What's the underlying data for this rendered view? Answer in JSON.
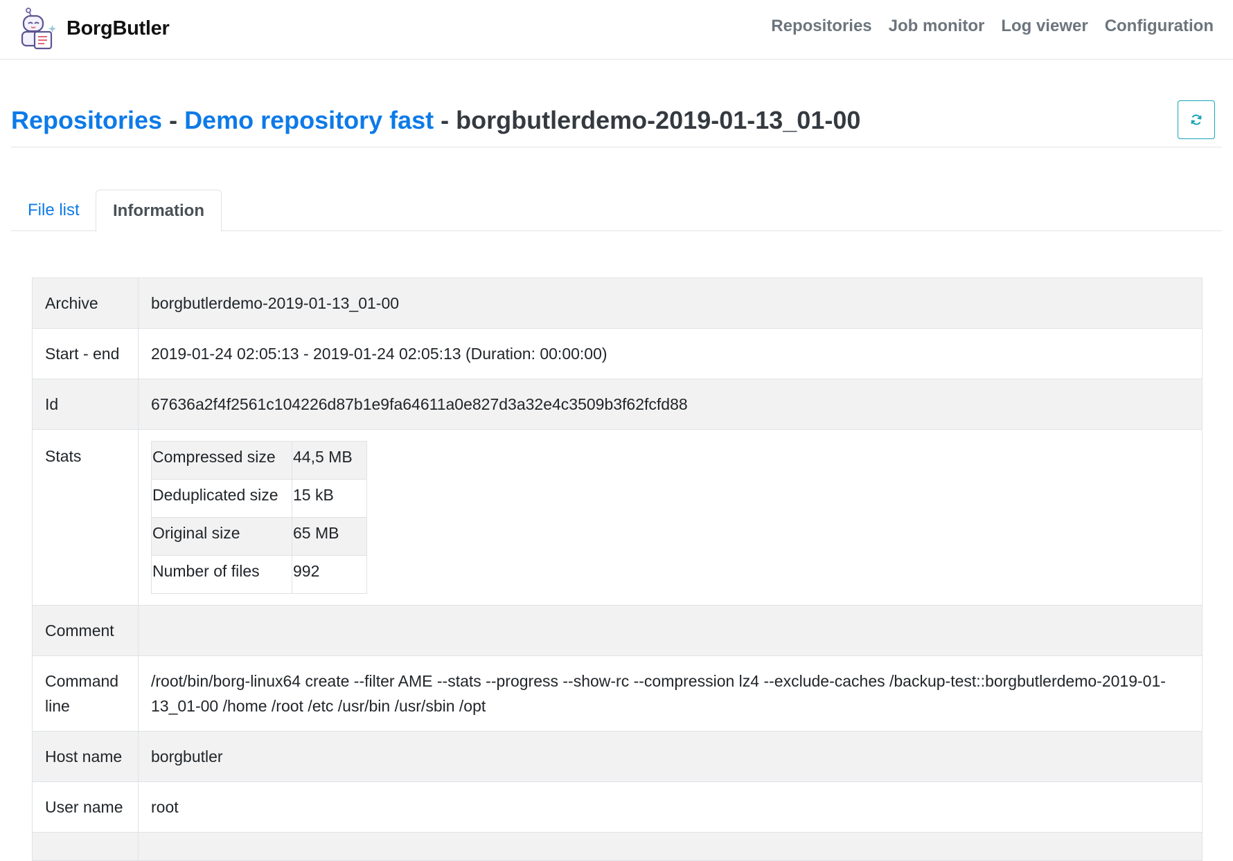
{
  "app": {
    "name": "BorgButler",
    "logo_icon": "borgbutler-logo-icon"
  },
  "nav": {
    "items": [
      {
        "label": "Repositories"
      },
      {
        "label": "Job monitor"
      },
      {
        "label": "Log viewer"
      },
      {
        "label": "Configuration"
      }
    ]
  },
  "header": {
    "crumb_repositories": "Repositories",
    "separator": " - ",
    "crumb_repository": "Demo repository fast",
    "archive_title": "borgbutlerdemo-2019-01-13_01-00",
    "refresh_icon": "refresh-icon"
  },
  "tabs": [
    {
      "label": "File list",
      "active": false
    },
    {
      "label": "Information",
      "active": true
    }
  ],
  "info": {
    "rows": [
      {
        "key": "Archive",
        "value": "borgbutlerdemo-2019-01-13_01-00"
      },
      {
        "key": "Start - end",
        "value": "2019-01-24 02:05:13 - 2019-01-24 02:05:13 (Duration: 00:00:00)"
      },
      {
        "key": "Id",
        "value": "67636a2f4f2561c104226d87b1e9fa64611a0e827d3a32e4c3509b3f62fcfd88"
      },
      {
        "key": "Stats",
        "value": ""
      },
      {
        "key": "Comment",
        "value": ""
      },
      {
        "key": "Command line",
        "value": "/root/bin/borg-linux64 create --filter AME --stats --progress --show-rc --compression lz4 --exclude-caches /backup-test::borgbutlerdemo-2019-01-13_01-00 /home /root /etc /usr/bin /usr/sbin /opt"
      },
      {
        "key": "Host name",
        "value": "borgbutler"
      },
      {
        "key": "User name",
        "value": "root"
      }
    ],
    "stats": [
      {
        "label": "Compressed size",
        "value": "44,5 MB"
      },
      {
        "label": "Deduplicated size",
        "value": "15 kB"
      },
      {
        "label": "Original size",
        "value": "65 MB"
      },
      {
        "label": "Number of files",
        "value": "992"
      }
    ]
  },
  "colors": {
    "link": "#0d7ae8",
    "nav_text": "#6c757d",
    "row_shade": "#f2f2f2",
    "refresh_border": "#17a2b8"
  }
}
